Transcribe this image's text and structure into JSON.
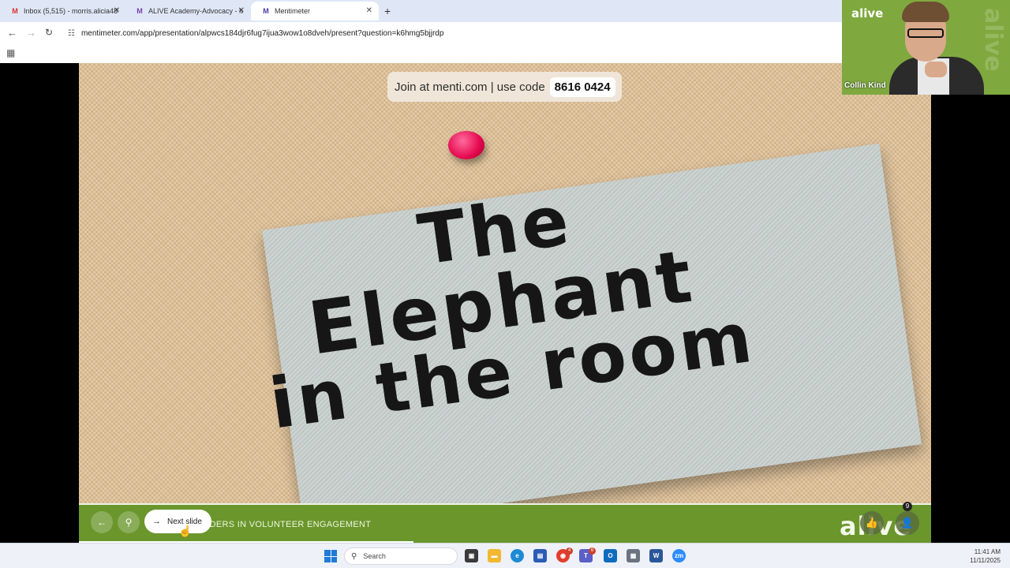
{
  "browser": {
    "tabs": [
      {
        "icon": "gmail-icon",
        "favicon_text": "M",
        "title": "Inbox (5,515) - morris.alicia485@",
        "active": false
      },
      {
        "icon": "alive-m-icon",
        "favicon_text": "M",
        "title": "ALIVE Academy-Advocacy - Me",
        "active": false
      },
      {
        "icon": "mentimeter-icon",
        "favicon_text": "M",
        "title": "Mentimeter",
        "active": true
      }
    ],
    "new_tab": "+",
    "url": "mentimeter.com/app/presentation/alpwcs184djr6fug7ijua3wow1o8dveh/present?question=k6hmg5bjjrdp"
  },
  "slide": {
    "join_text": "Join at menti.com | use code",
    "join_code": "8616 0424",
    "lines": [
      "The",
      "Elephant",
      "in the room"
    ]
  },
  "footer": {
    "next_slide_label": "Next slide",
    "presentation_title": "ADERS IN VOLUNTEER ENGAGEMENT",
    "logo_text": "alive",
    "participants_count": "9"
  },
  "video": {
    "logo_text": "alive",
    "watermark": "alive",
    "participant_name": "Collin Kind"
  },
  "taskbar": {
    "search_placeholder": "Search",
    "time": "11:41 AM",
    "date": "11/11/2025",
    "chrome_badge": "4",
    "teams_badge": "6"
  },
  "colors": {
    "footer_bg": "#6a962c",
    "video_bg": "#7fa93e",
    "pin": "#e4084e"
  }
}
